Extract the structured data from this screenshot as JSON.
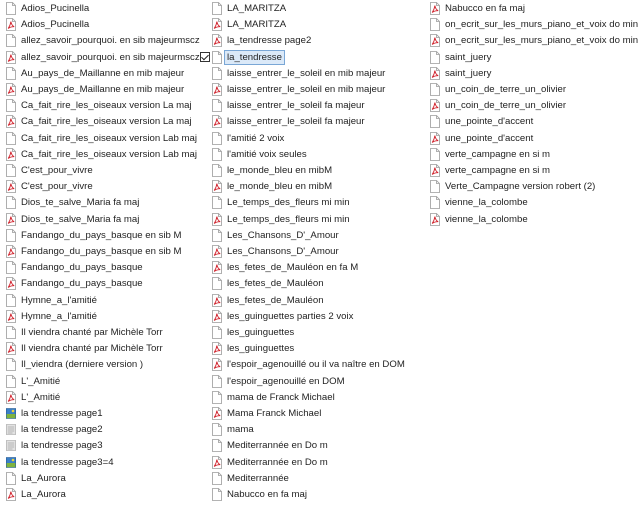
{
  "columns": [
    [
      {
        "name": "Adios_Pucinella",
        "type": "doc"
      },
      {
        "name": "Adios_Pucinella",
        "type": "pdf"
      },
      {
        "name": "allez_savoir_pourquoi. en sib majeurmscz",
        "type": "doc"
      },
      {
        "name": "allez_savoir_pourquoi. en sib majeurmscz",
        "type": "pdf"
      },
      {
        "name": "Au_pays_de_Maillanne en mib majeur",
        "type": "doc"
      },
      {
        "name": "Au_pays_de_Maillanne en mib majeur",
        "type": "pdf"
      },
      {
        "name": "Ca_fait_rire_les_oiseaux version La maj",
        "type": "doc"
      },
      {
        "name": "Ca_fait_rire_les_oiseaux version La maj",
        "type": "pdf"
      },
      {
        "name": "Ca_fait_rire_les_oiseaux version Lab maj",
        "type": "doc"
      },
      {
        "name": "Ca_fait_rire_les_oiseaux version Lab maj",
        "type": "pdf"
      },
      {
        "name": "C'est_pour_vivre",
        "type": "doc"
      },
      {
        "name": "C'est_pour_vivre",
        "type": "pdf"
      },
      {
        "name": "Dios_te_salve_Maria fa maj",
        "type": "doc"
      },
      {
        "name": "Dios_te_salve_Maria fa maj",
        "type": "pdf"
      },
      {
        "name": "Fandango_du_pays_basque en sib M",
        "type": "doc"
      },
      {
        "name": "Fandango_du_pays_basque en sib M",
        "type": "pdf"
      },
      {
        "name": "Fandango_du_pays_basque",
        "type": "doc"
      },
      {
        "name": "Fandango_du_pays_basque",
        "type": "pdf"
      },
      {
        "name": "Hymne_a_l'amitié",
        "type": "doc"
      },
      {
        "name": "Hymne_a_l'amitié",
        "type": "pdf"
      },
      {
        "name": "Il viendra chanté par Michèle Torr",
        "type": "doc"
      },
      {
        "name": "Il viendra chanté par Michèle Torr",
        "type": "pdf"
      },
      {
        "name": "Il_viendra (derniere version )",
        "type": "doc"
      },
      {
        "name": "L'_Amitié",
        "type": "doc"
      },
      {
        "name": "L'_Amitié",
        "type": "pdf"
      },
      {
        "name": "la tendresse page1",
        "type": "img"
      },
      {
        "name": "la tendresse page2",
        "type": "img-gray"
      },
      {
        "name": "la tendresse page3",
        "type": "img-gray"
      },
      {
        "name": "la tendresse page3=4",
        "type": "img"
      },
      {
        "name": "La_Aurora",
        "type": "doc"
      },
      {
        "name": "La_Aurora",
        "type": "pdf"
      }
    ],
    [
      {
        "name": "LA_MARITZA",
        "type": "doc"
      },
      {
        "name": "LA_MARITZA",
        "type": "pdf"
      },
      {
        "name": "la_tendresse page2",
        "type": "pdf"
      },
      {
        "name": "la_tendresse",
        "type": "doc",
        "selected": true
      },
      {
        "name": "laisse_entrer_le_soleil en mib majeur",
        "type": "doc"
      },
      {
        "name": "laisse_entrer_le_soleil en mib majeur",
        "type": "pdf"
      },
      {
        "name": "laisse_entrer_le_soleil fa majeur",
        "type": "doc"
      },
      {
        "name": "laisse_entrer_le_soleil fa majeur",
        "type": "pdf"
      },
      {
        "name": "l'amitié 2 voix",
        "type": "doc"
      },
      {
        "name": "l'amitié voix seules",
        "type": "doc"
      },
      {
        "name": "le_monde_bleu en mibM",
        "type": "doc"
      },
      {
        "name": "le_monde_bleu en mibM",
        "type": "pdf"
      },
      {
        "name": "Le_temps_des_fleurs mi min",
        "type": "doc"
      },
      {
        "name": "Le_temps_des_fleurs mi min",
        "type": "pdf"
      },
      {
        "name": "Les_Chansons_D'_Amour",
        "type": "doc"
      },
      {
        "name": "Les_Chansons_D'_Amour",
        "type": "pdf"
      },
      {
        "name": "les_fetes_de_Mauléon en fa M",
        "type": "pdf"
      },
      {
        "name": "les_fetes_de_Mauléon",
        "type": "doc"
      },
      {
        "name": "les_fetes_de_Mauléon",
        "type": "pdf"
      },
      {
        "name": "les_guinguettes parties 2 voix",
        "type": "pdf"
      },
      {
        "name": "les_guinguettes",
        "type": "doc"
      },
      {
        "name": "les_guinguettes",
        "type": "pdf"
      },
      {
        "name": "l'espoir_agenouillé  ou il va naître en DOM",
        "type": "pdf"
      },
      {
        "name": "l'espoir_agenouillé en DOM",
        "type": "doc"
      },
      {
        "name": "mama de Franck Michael",
        "type": "doc"
      },
      {
        "name": "Mama Franck Michael",
        "type": "pdf"
      },
      {
        "name": "mama",
        "type": "doc"
      },
      {
        "name": "Mediterrannée en Do m",
        "type": "doc"
      },
      {
        "name": "Mediterrannée en Do m",
        "type": "pdf"
      },
      {
        "name": "Mediterrannée",
        "type": "doc"
      },
      {
        "name": "Nabucco en fa maj",
        "type": "doc"
      }
    ],
    [
      {
        "name": "Nabucco en fa maj",
        "type": "pdf"
      },
      {
        "name": "on_ecrit_sur_les_murs_piano_et_voix do min",
        "type": "doc"
      },
      {
        "name": "on_ecrit_sur_les_murs_piano_et_voix do min",
        "type": "pdf"
      },
      {
        "name": "saint_juery",
        "type": "doc"
      },
      {
        "name": "saint_juery",
        "type": "pdf"
      },
      {
        "name": "un_coin_de_terre_un_olivier",
        "type": "doc"
      },
      {
        "name": "un_coin_de_terre_un_olivier",
        "type": "pdf"
      },
      {
        "name": "une_pointe_d'accent",
        "type": "doc"
      },
      {
        "name": "une_pointe_d'accent",
        "type": "pdf"
      },
      {
        "name": "verte_campagne en si m",
        "type": "doc"
      },
      {
        "name": "verte_campagne en si m",
        "type": "pdf"
      },
      {
        "name": "Verte_Campagne version robert (2)",
        "type": "doc"
      },
      {
        "name": "vienne_la_colombe",
        "type": "doc"
      },
      {
        "name": "vienne_la_colombe",
        "type": "pdf"
      }
    ]
  ]
}
